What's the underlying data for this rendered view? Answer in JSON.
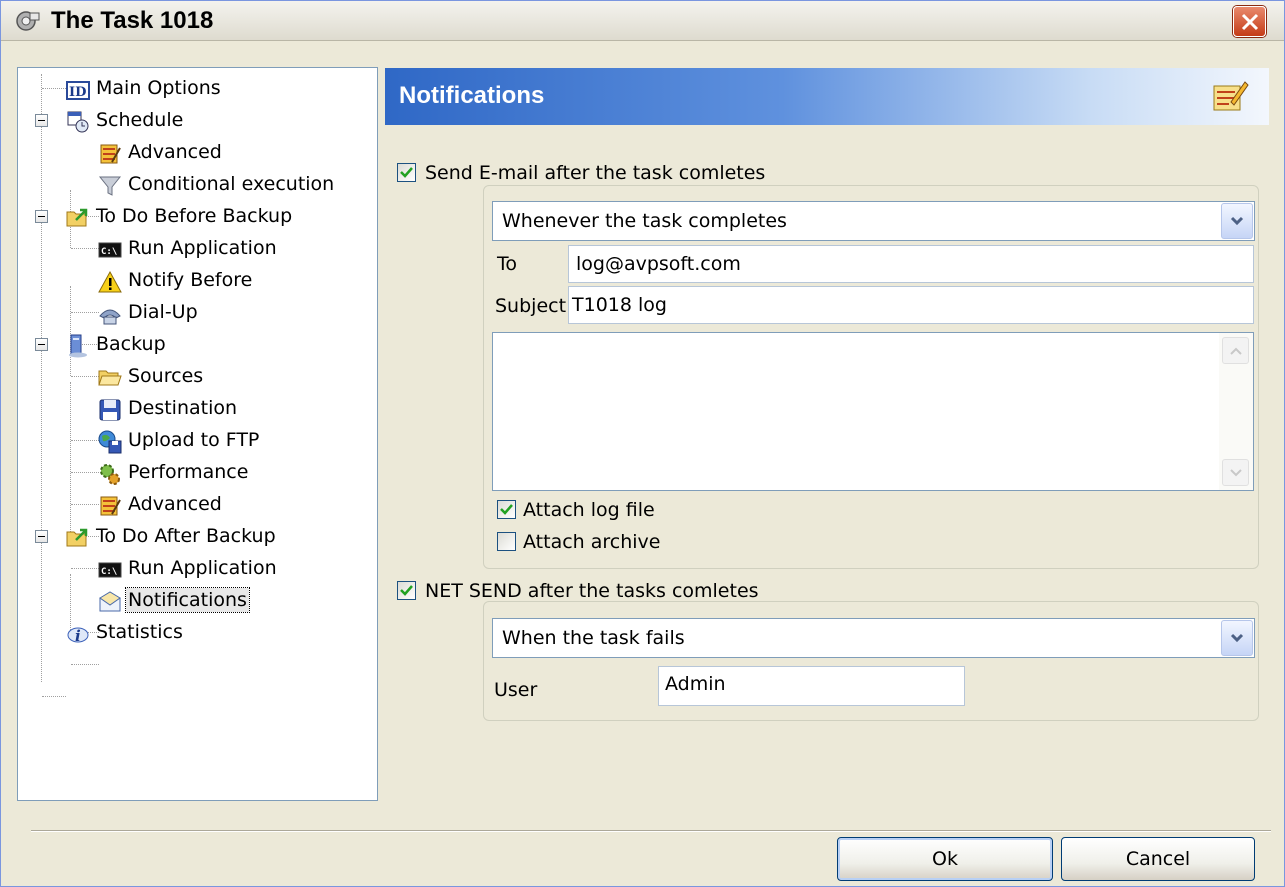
{
  "window": {
    "title": "The Task 1018"
  },
  "tree": {
    "items": [
      {
        "label": "Main Options",
        "icon": "id-icon"
      },
      {
        "label": "Schedule",
        "icon": "calendar-clock-icon"
      },
      {
        "label": "Advanced",
        "icon": "advanced-settings-icon"
      },
      {
        "label": "Conditional execution",
        "icon": "funnel-icon"
      },
      {
        "label": "To Do Before Backup",
        "icon": "folder-arrow-icon"
      },
      {
        "label": "Run Application",
        "icon": "console-icon"
      },
      {
        "label": "Notify Before",
        "icon": "warning-icon"
      },
      {
        "label": "Dial-Up",
        "icon": "dialup-icon"
      },
      {
        "label": "Backup",
        "icon": "computer-icon"
      },
      {
        "label": "Sources",
        "icon": "folder-open-icon"
      },
      {
        "label": "Destination",
        "icon": "floppy-disk-icon"
      },
      {
        "label": "Upload to FTP",
        "icon": "globe-disk-icon"
      },
      {
        "label": "Performance",
        "icon": "gears-icon"
      },
      {
        "label": "Advanced",
        "icon": "advanced-settings-icon"
      },
      {
        "label": "To Do After Backup",
        "icon": "folder-arrow-icon"
      },
      {
        "label": "Run Application",
        "icon": "console-icon"
      },
      {
        "label": "Notifications",
        "icon": "envelope-icon"
      },
      {
        "label": "Statistics",
        "icon": "info-icon"
      }
    ],
    "selected": "Notifications"
  },
  "panel": {
    "title": "Notifications",
    "email": {
      "checkbox_label": "Send E-mail after the task comletes",
      "checked": true,
      "when": "Whenever the task completes",
      "to_label": "To",
      "to_value": "log@avpsoft.com",
      "subject_label": "Subject",
      "subject_value": "T1018 log",
      "body": "",
      "attach_log_label": "Attach log file",
      "attach_log_checked": true,
      "attach_archive_label": "Attach archive",
      "attach_archive_checked": false
    },
    "netsend": {
      "checkbox_label": "NET SEND after the tasks comletes",
      "checked": true,
      "when": "When the task fails",
      "user_label": "User",
      "user_value": "Admin"
    }
  },
  "buttons": {
    "ok": "Ok",
    "cancel": "Cancel"
  }
}
